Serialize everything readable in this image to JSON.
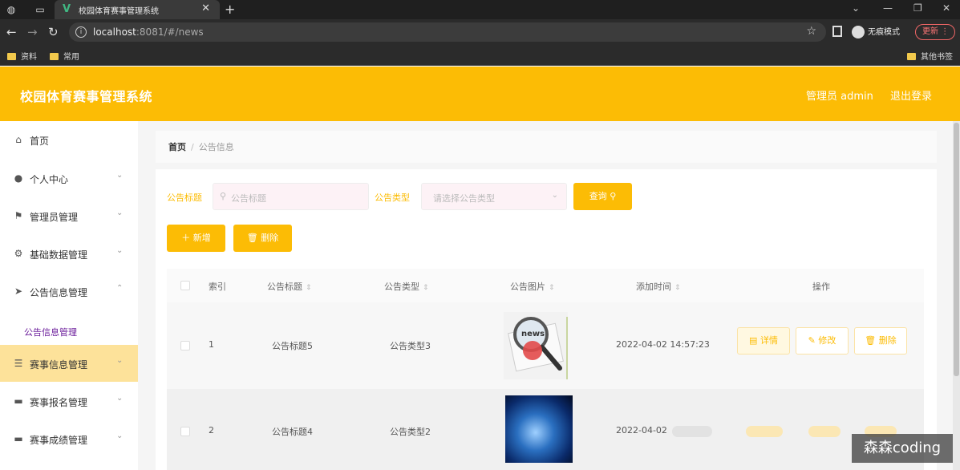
{
  "browser": {
    "tab_title": "校园体育赛事管理系统",
    "url_host": "localhost",
    "url_rest": ":8081/#/news",
    "incognito_label": "无痕模式",
    "update_label": "更新",
    "bookmarks": [
      "资料",
      "常用"
    ],
    "other_bookmarks": "其他书签"
  },
  "header": {
    "title": "校园体育赛事管理系统",
    "user": "管理员 admin",
    "logout": "退出登录"
  },
  "sidebar": {
    "items": [
      {
        "label": "首页",
        "icon": "home-icon"
      },
      {
        "label": "个人中心",
        "icon": "user-icon"
      },
      {
        "label": "管理员管理",
        "icon": "flag-icon"
      },
      {
        "label": "基础数据管理",
        "icon": "gear-icon"
      },
      {
        "label": "公告信息管理",
        "icon": "send-icon"
      },
      {
        "label": "赛事信息管理",
        "icon": "sliders-icon"
      },
      {
        "label": "赛事报名管理",
        "icon": "monitor-icon"
      },
      {
        "label": "赛事成绩管理",
        "icon": "monitor-icon"
      }
    ],
    "sub_item": "公告信息管理"
  },
  "breadcrumb": {
    "home": "首页",
    "current": "公告信息"
  },
  "filters": {
    "title_label": "公告标题",
    "title_placeholder": "公告标题",
    "type_label": "公告类型",
    "type_placeholder": "请选择公告类型",
    "search_button": "查询"
  },
  "actions": {
    "add": "新增",
    "delete": "删除"
  },
  "table": {
    "columns": [
      "索引",
      "公告标题",
      "公告类型",
      "公告图片",
      "添加时间",
      "操作"
    ],
    "rows": [
      {
        "index": "1",
        "title": "公告标题5",
        "type": "公告类型3",
        "time": "2022-04-02 14:57:23"
      },
      {
        "index": "2",
        "title": "公告标题4",
        "type": "公告类型2",
        "time": "2022-04-02"
      }
    ],
    "ops": {
      "detail": "详情",
      "edit": "修改",
      "delete": "删除"
    }
  },
  "watermark": "森森coding",
  "colors": {
    "accent": "#fcbc05",
    "submenu": "#6a1b9a"
  }
}
